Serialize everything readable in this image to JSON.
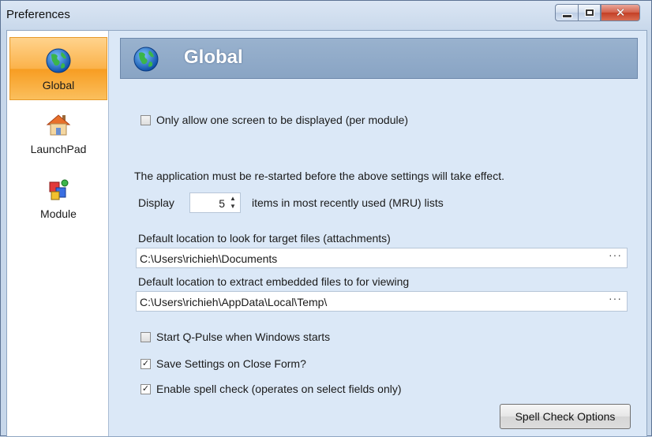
{
  "window": {
    "title": "Preferences"
  },
  "sidebar": {
    "items": [
      {
        "label": "Global",
        "icon": "globe-icon",
        "selected": true
      },
      {
        "label": "LaunchPad",
        "icon": "home-icon",
        "selected": false
      },
      {
        "label": "Module",
        "icon": "module-icon",
        "selected": false
      }
    ]
  },
  "header": {
    "title": "Global",
    "icon": "globe-icon"
  },
  "settings": {
    "one_screen": {
      "label": "Only allow one screen to be displayed (per module)",
      "checked": false
    },
    "restart_note": "The application must be re-started before the above settings will take effect.",
    "mru": {
      "prefix": "Display",
      "value": "5",
      "suffix": "items in most recently used (MRU) lists"
    },
    "attachments": {
      "label": "Default location to look for target files (attachments)",
      "value": "C:\\Users\\richieh\\Documents",
      "browse": "···"
    },
    "extract": {
      "label": "Default location to extract embedded files to for viewing",
      "value": "C:\\Users\\richieh\\AppData\\Local\\Temp\\",
      "browse": "···"
    },
    "start_with_windows": {
      "label": "Start Q-Pulse when Windows starts",
      "checked": false
    },
    "save_on_close": {
      "label": "Save Settings on Close Form?",
      "checked": true
    },
    "spell_check": {
      "label": "Enable spell check (operates on select fields only)",
      "checked": true
    }
  },
  "buttons": {
    "spell_check_options": "Spell Check Options"
  },
  "colors": {
    "accent_orange": "#f79d22",
    "header_blue": "#89a4c4",
    "panel_bg": "#dbe8f7"
  }
}
